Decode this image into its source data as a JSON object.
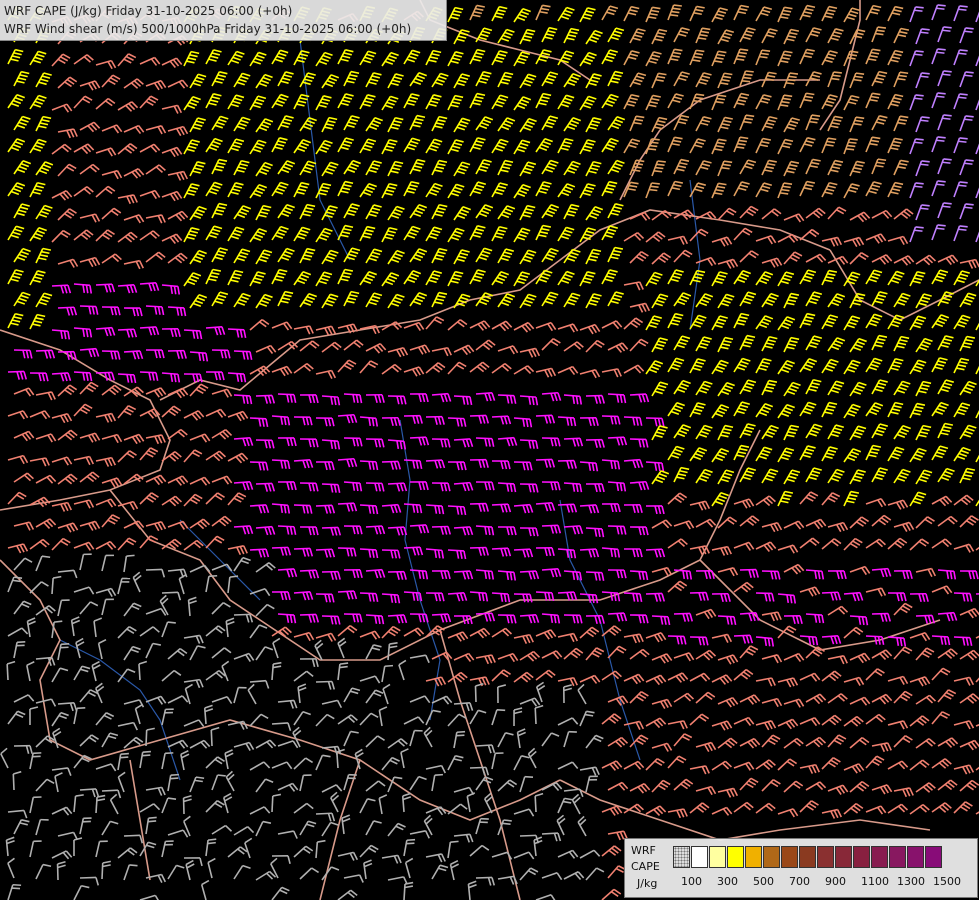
{
  "title": {
    "line1": "WRF CAPE (J/kg) Friday 31-10-2025 06:00 (+0h)",
    "line2": "WRF Wind shear (m/s) 500/1000hPa Friday 31-10-2025 06:00 (+0h)"
  },
  "legend": {
    "model": "WRF",
    "variable": "CAPE",
    "unit": "J/kg",
    "ticks": [
      "100",
      "300",
      "500",
      "700",
      "900",
      "1100",
      "1300",
      "1500"
    ],
    "colors": [
      "#ffffff",
      "#ffffa0",
      "#ffff00",
      "#f0b000",
      "#b06818",
      "#9a4818",
      "#8a3a20",
      "#8a3030",
      "#882838",
      "#882040",
      "#881c50",
      "#881860",
      "#88126c",
      "#880c78"
    ]
  },
  "map": {
    "background": "#000000",
    "barb_colors": {
      "yellow": "#ffff00",
      "tan": "#e0a060",
      "salmon": "#f08070",
      "magenta": "#ff10ff",
      "gray": "#b0b0b0",
      "lightpurple": "#c080ff"
    },
    "border_color": "#d89a8a",
    "river_color": "#2a58a8"
  }
}
